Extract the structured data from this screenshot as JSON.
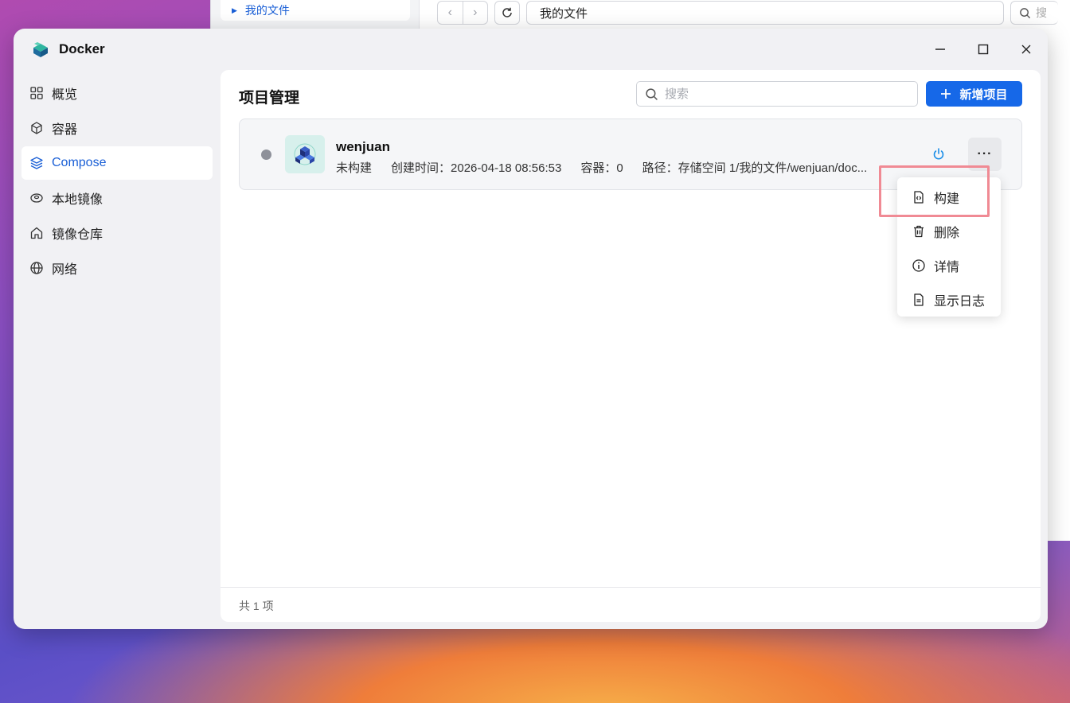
{
  "background_window": {
    "sidebar_item": "我的文件",
    "path": "我的文件",
    "search_partial": "搜"
  },
  "window": {
    "title": "Docker"
  },
  "sidebar": {
    "items": [
      {
        "label": "概览",
        "icon": "grid-icon"
      },
      {
        "label": "容器",
        "icon": "cube-icon"
      },
      {
        "label": "Compose",
        "icon": "layers-icon",
        "active": true
      },
      {
        "label": "本地镜像",
        "icon": "disc-icon"
      },
      {
        "label": "镜像仓库",
        "icon": "home-icon"
      },
      {
        "label": "网络",
        "icon": "globe-icon"
      }
    ]
  },
  "main": {
    "title": "项目管理",
    "search_placeholder": "搜索",
    "add_button": "新增项目",
    "projects": [
      {
        "name": "wenjuan",
        "status": "未构建",
        "created": "创建时间：2026-04-18 08:56:53",
        "containers": "容器：0",
        "path": "路径：存储空间 1/我的文件/wenjuan/doc..."
      }
    ],
    "footer": "共 1 项"
  },
  "context_menu": {
    "items": [
      {
        "label": "构建",
        "icon": "build-file-icon"
      },
      {
        "label": "删除",
        "icon": "trash-icon"
      },
      {
        "label": "详情",
        "icon": "info-icon"
      },
      {
        "label": "显示日志",
        "icon": "log-file-icon"
      }
    ]
  },
  "colors": {
    "accent": "#1668e8",
    "highlight_box": "#f08a94",
    "status_dot": "#8e919a"
  }
}
